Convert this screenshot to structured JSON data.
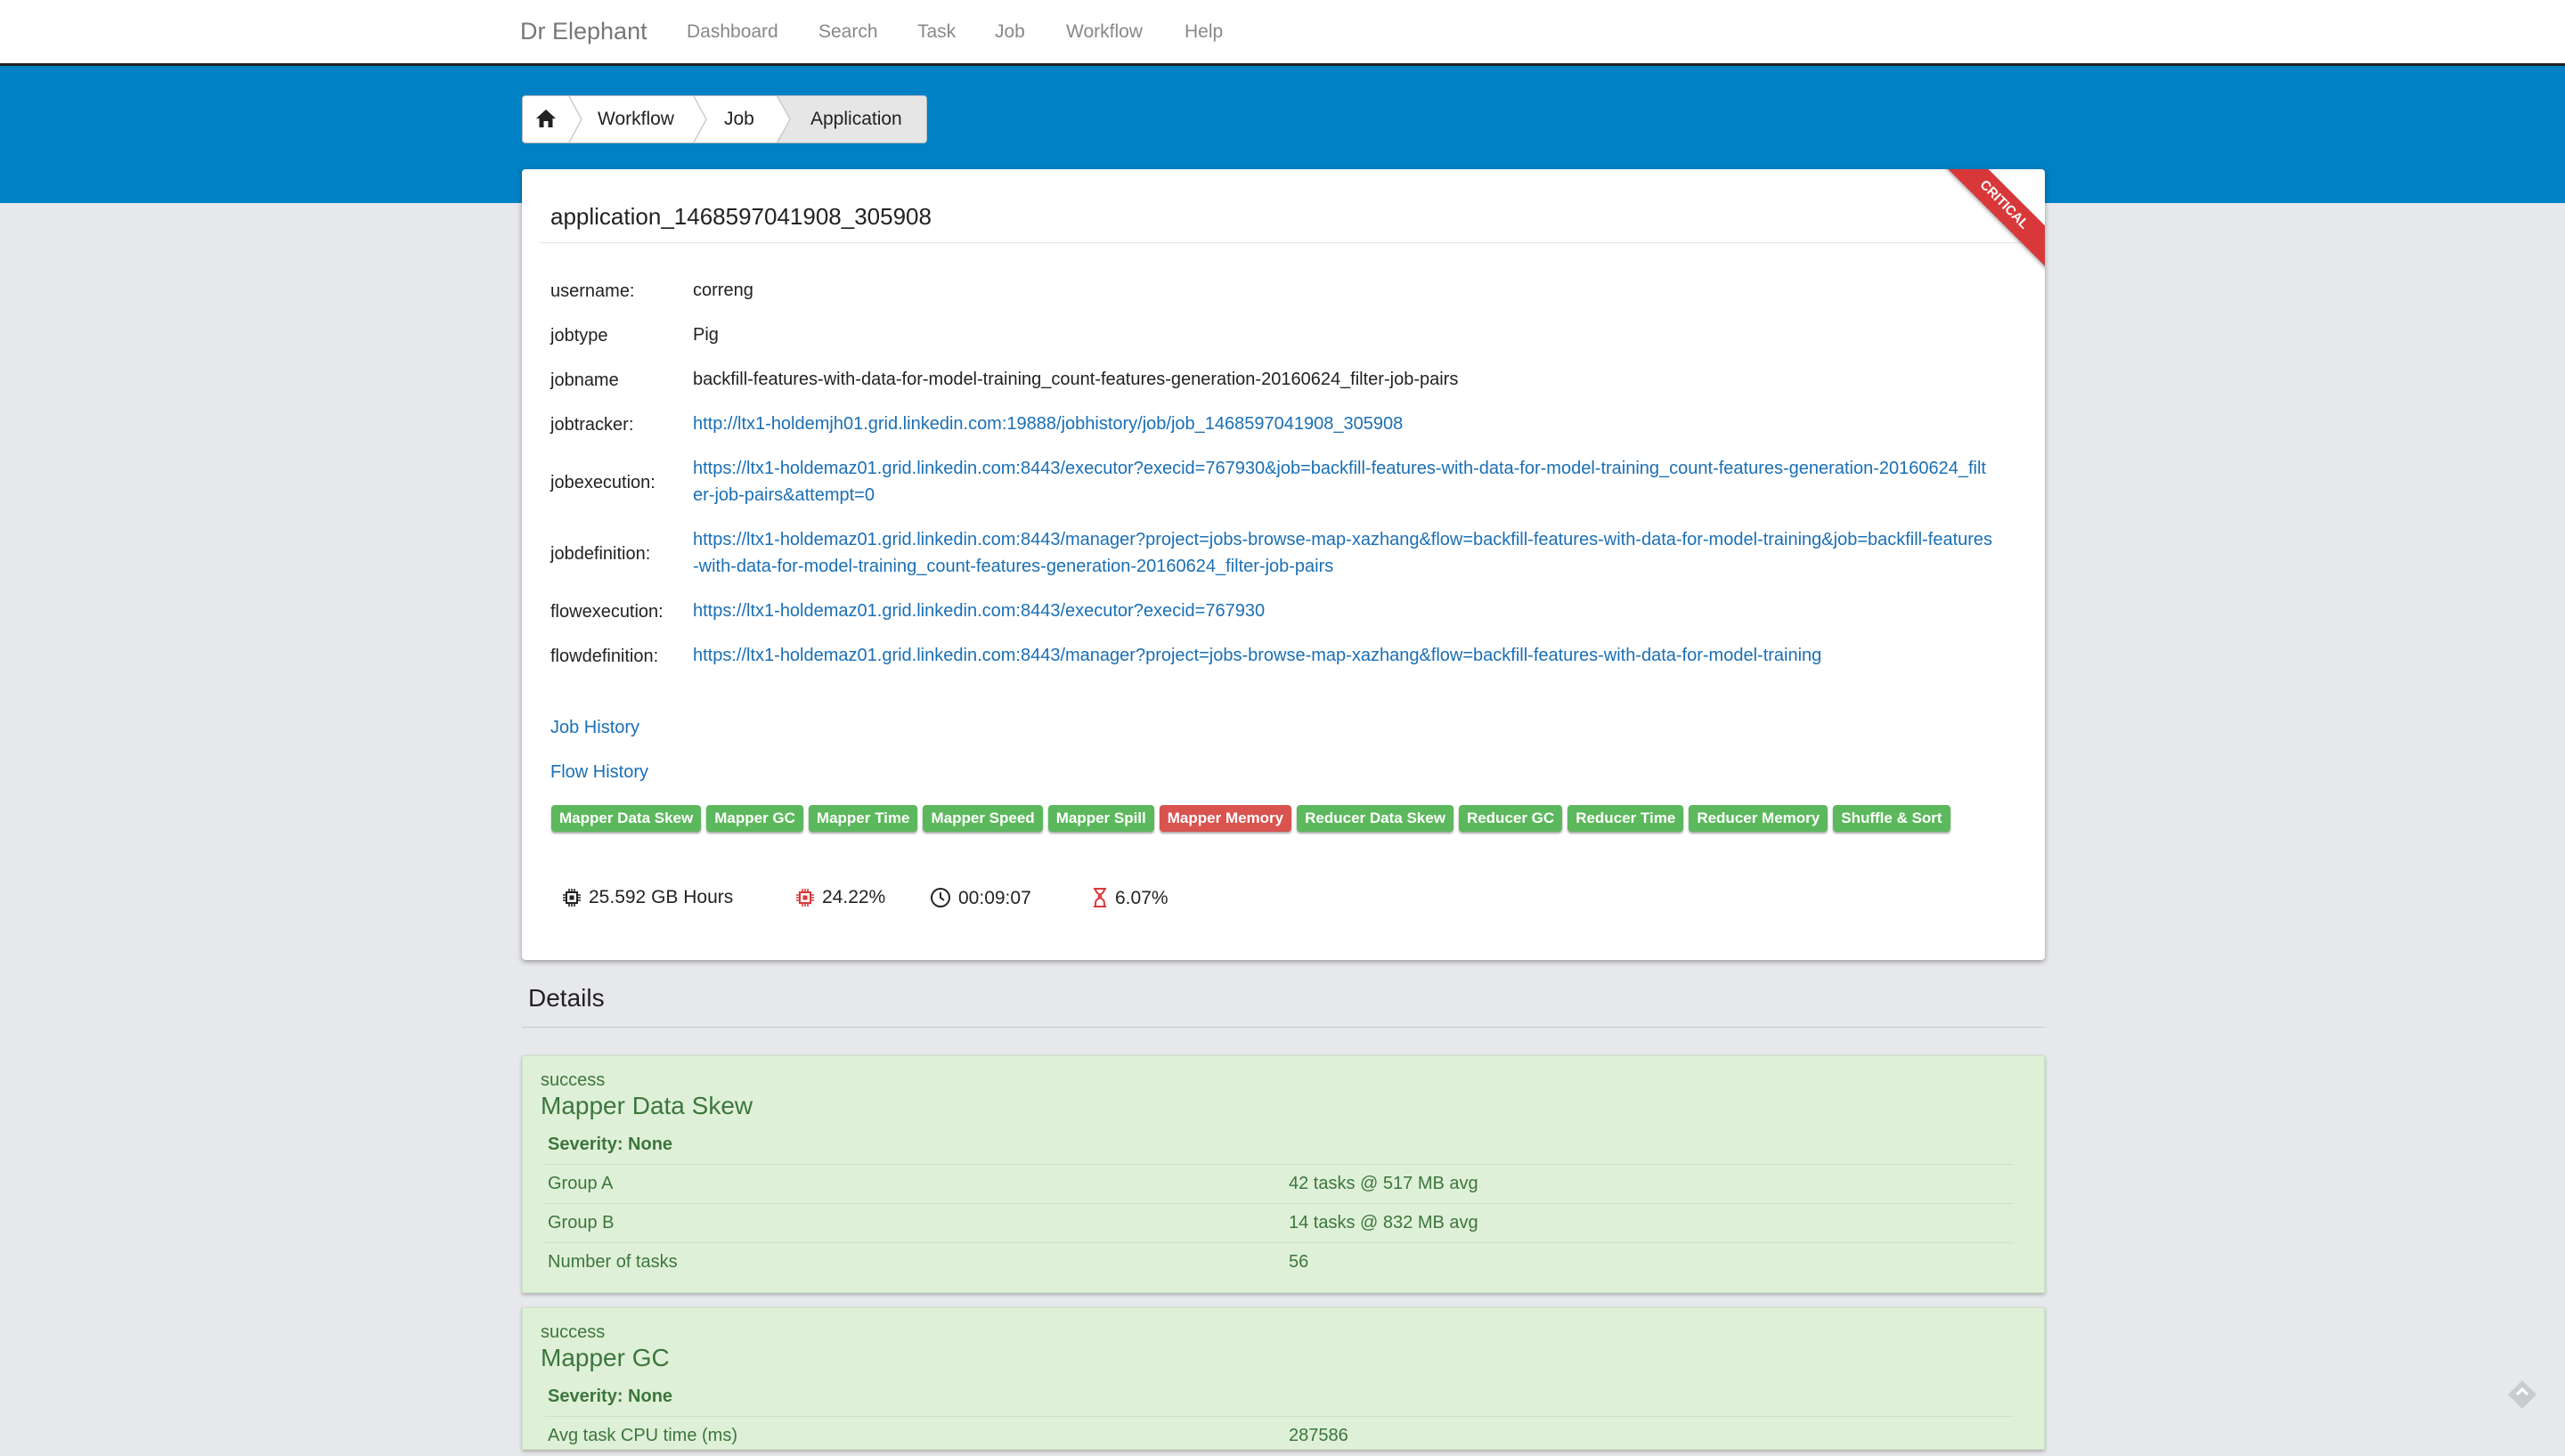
{
  "navbar": {
    "brand": "Dr Elephant",
    "links": [
      "Dashboard",
      "Search",
      "Task",
      "Job",
      "Workflow",
      "Help"
    ]
  },
  "breadcrumb": {
    "items": [
      "Workflow",
      "Job",
      "Application"
    ]
  },
  "app": {
    "title": "application_1468597041908_305908",
    "ribbon": "CRITICAL",
    "fields": {
      "username": {
        "label": "username:",
        "value": "correng"
      },
      "jobtype": {
        "label": "jobtype",
        "value": "Pig"
      },
      "jobname": {
        "label": "jobname",
        "value": "backfill-features-with-data-for-model-training_count-features-generation-20160624_filter-job-pairs"
      },
      "jobtracker": {
        "label": "jobtracker:",
        "value": "http://ltx1-holdemjh01.grid.linkedin.com:19888/jobhistory/job/job_1468597041908_305908"
      },
      "jobexecution": {
        "label": "jobexecution:",
        "value": "https://ltx1-holdemaz01.grid.linkedin.com:8443/executor?execid=767930&job=backfill-features-with-data-for-model-training_count-features-generation-20160624_filter-job-pairs&attempt=0"
      },
      "jobdefinition": {
        "label": "jobdefinition:",
        "value": "https://ltx1-holdemaz01.grid.linkedin.com:8443/manager?project=jobs-browse-map-xazhang&flow=backfill-features-with-data-for-model-training&job=backfill-features-with-data-for-model-training_count-features-generation-20160624_filter-job-pairs"
      },
      "flowexecution": {
        "label": "flowexecution:",
        "value": "https://ltx1-holdemaz01.grid.linkedin.com:8443/executor?execid=767930"
      },
      "flowdefinition": {
        "label": "flowdefinition:",
        "value": "https://ltx1-holdemaz01.grid.linkedin.com:8443/manager?project=jobs-browse-map-xazhang&flow=backfill-features-with-data-for-model-training"
      }
    },
    "job_history": "Job History",
    "flow_history": "Flow History",
    "heuristics": [
      {
        "label": "Mapper Data Skew",
        "status": "green"
      },
      {
        "label": "Mapper GC",
        "status": "green"
      },
      {
        "label": "Mapper Time",
        "status": "green"
      },
      {
        "label": "Mapper Speed",
        "status": "green"
      },
      {
        "label": "Mapper Spill",
        "status": "green"
      },
      {
        "label": "Mapper Memory",
        "status": "red"
      },
      {
        "label": "Reducer Data Skew",
        "status": "green"
      },
      {
        "label": "Reducer GC",
        "status": "green"
      },
      {
        "label": "Reducer Time",
        "status": "green"
      },
      {
        "label": "Reducer Memory",
        "status": "green"
      },
      {
        "label": "Shuffle & Sort",
        "status": "green"
      }
    ],
    "stats": {
      "resource": "25.592 GB Hours",
      "wasted": "24.22%",
      "runtime": "00:09:07",
      "wait": "6.07%"
    }
  },
  "details": {
    "title": "Details",
    "panels": [
      {
        "status": "success",
        "name": "Mapper Data Skew",
        "severity": "Severity: None",
        "rows": [
          {
            "key": "Group A",
            "value": "42 tasks @ 517 MB avg"
          },
          {
            "key": "Group B",
            "value": "14 tasks @ 832 MB avg"
          },
          {
            "key": "Number of tasks",
            "value": "56"
          }
        ]
      },
      {
        "status": "success",
        "name": "Mapper GC",
        "severity": "Severity: None",
        "rows": [
          {
            "key": "Avg task CPU time (ms)",
            "value": "287586"
          }
        ]
      }
    ]
  },
  "colors": {
    "band": "#0181c5",
    "success_bg": "#dff0d8",
    "success_text": "#3c763d",
    "tag_green": "#5cb85c",
    "tag_red": "#d9534f",
    "ribbon": "#d9383a",
    "link": "#1a6fb5"
  },
  "icons": [
    "home-icon",
    "cpu-icon",
    "cpu-red-icon",
    "clock-icon",
    "hourglass-icon",
    "bookmark-icon"
  ]
}
